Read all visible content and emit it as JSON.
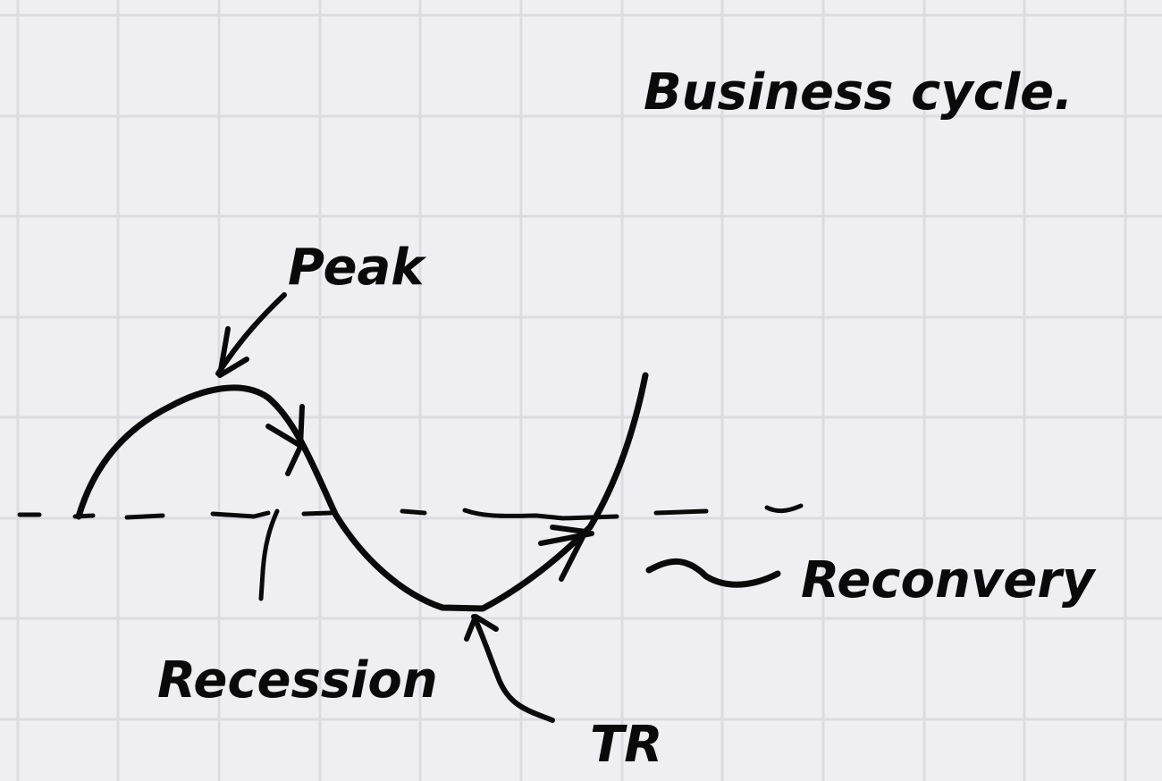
{
  "diagram": {
    "title": "Business cycle.",
    "labels": {
      "peak": "Peak",
      "recession": "Recession",
      "trough": "TR",
      "recovery": "Reconvery"
    }
  }
}
